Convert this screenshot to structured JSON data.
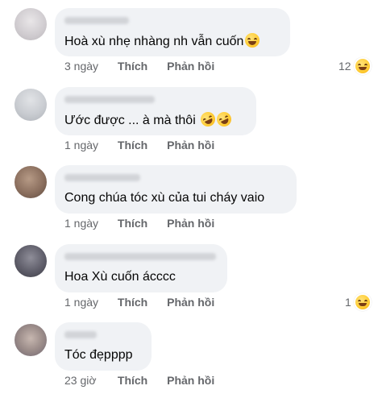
{
  "comments": [
    {
      "text": "Hoà xù nhẹ nhàng nh vẫn cuốn",
      "emoji": "grinning-squinting-face",
      "time": "3 ngày",
      "like": "Thích",
      "reply": "Phản hồi",
      "reaction_count": "12",
      "reaction_icon": "haha-reaction"
    },
    {
      "text": "Ước được ... à mà thôi",
      "emoji": "rolling-on-floor-laughing-face",
      "time": "1 ngày",
      "like": "Thích",
      "reply": "Phản hồi"
    },
    {
      "text": "Cong chúa tóc xù của tui cháy vaio",
      "time": "1 ngày",
      "like": "Thích",
      "reply": "Phản hồi"
    },
    {
      "text": "Hoa Xù cuốn ácccc",
      "time": "1 ngày",
      "like": "Thích",
      "reply": "Phản hồi",
      "reaction_count": "1",
      "reaction_icon": "haha-reaction"
    },
    {
      "text": "Tóc đẹpppp",
      "time": "23 giờ",
      "like": "Thích",
      "reply": "Phản hồi"
    }
  ]
}
